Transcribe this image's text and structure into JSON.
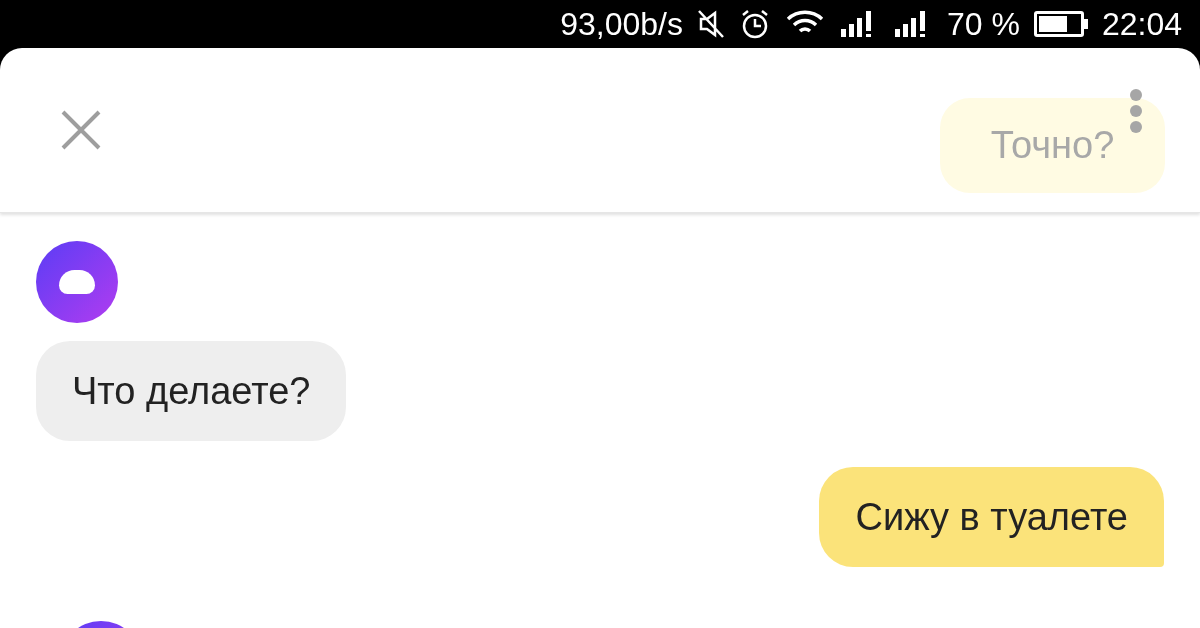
{
  "status_bar": {
    "speed": "93,00b/s",
    "battery_percent": "70 %",
    "time": "22:04"
  },
  "header": {
    "faded_message": "Точно?"
  },
  "messages": [
    {
      "kind": "incoming",
      "text": "Что делаете?"
    },
    {
      "kind": "outgoing",
      "text": "Сижу в туалете"
    }
  ]
}
